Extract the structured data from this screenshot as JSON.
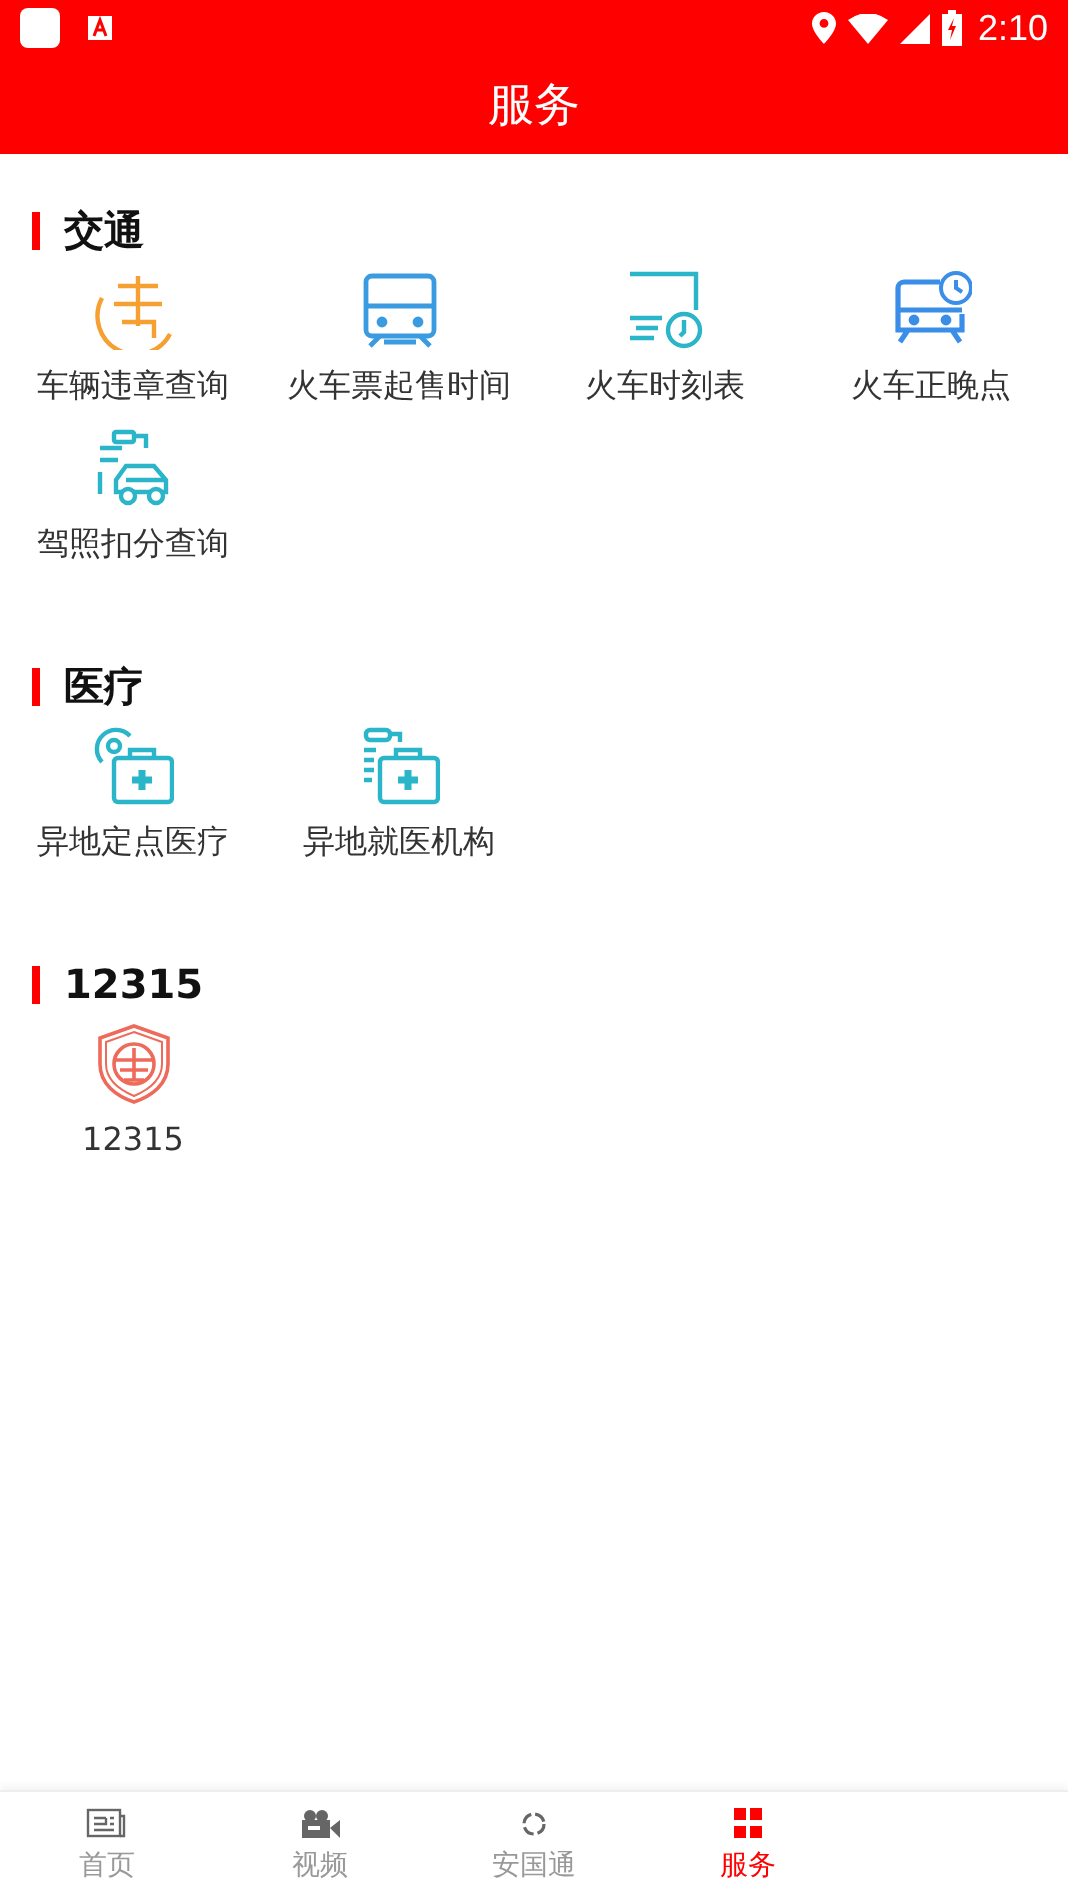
{
  "status_bar": {
    "time": "2:10"
  },
  "header": {
    "title": "服务"
  },
  "sections": [
    {
      "title": "交通",
      "items": [
        {
          "label": "车辆违章查询",
          "kind": "violation"
        },
        {
          "label": "火车票起售时间",
          "kind": "train"
        },
        {
          "label": "火车时刻表",
          "kind": "timetable"
        },
        {
          "label": "火车正晚点",
          "kind": "trainclock"
        },
        {
          "label": "驾照扣分查询",
          "kind": "license"
        }
      ]
    },
    {
      "title": "医疗",
      "items": [
        {
          "label": "异地定点医疗",
          "kind": "medpin"
        },
        {
          "label": "异地就医机构",
          "kind": "medlist"
        }
      ]
    },
    {
      "title": "12315",
      "items": [
        {
          "label": "12315",
          "kind": "badge"
        }
      ]
    }
  ],
  "bottom_nav": [
    {
      "label": "首页",
      "kind": "news",
      "selected": false
    },
    {
      "label": "视频",
      "kind": "camera",
      "selected": false
    },
    {
      "label": "安国通",
      "kind": "ring",
      "selected": false
    },
    {
      "label": "服务",
      "kind": "grid",
      "selected": true
    }
  ]
}
